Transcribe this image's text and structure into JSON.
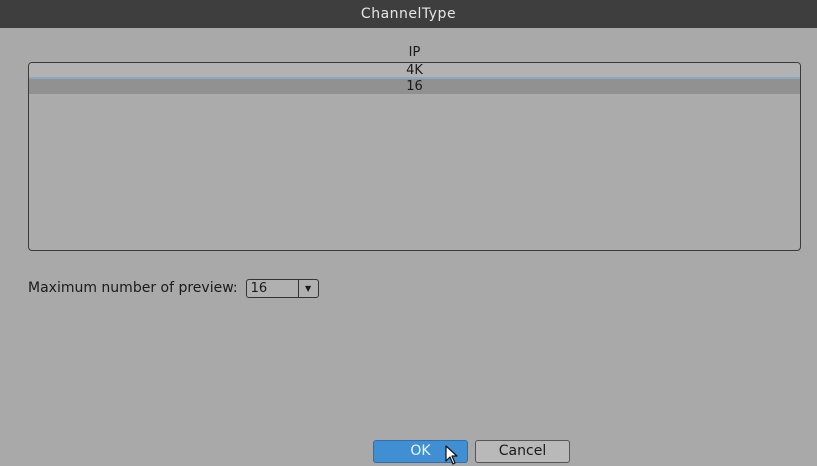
{
  "window": {
    "title": "ChannelType"
  },
  "list": {
    "header": "IP",
    "rows": [
      {
        "label": "4K",
        "selected": false
      },
      {
        "label": "16",
        "selected": true
      }
    ]
  },
  "preview": {
    "label": "Maximum number of preview:",
    "value": "16"
  },
  "buttons": {
    "ok": "OK",
    "cancel": "Cancel"
  },
  "colors": {
    "title_bar": "#3e3e3e",
    "background": "#a8a9a8",
    "selected_row": "#919191",
    "ok_button": "#3f8fd2"
  },
  "icons": {
    "select_arrow": "dropdown-arrow-icon",
    "cursor": "mouse-pointer-icon"
  }
}
